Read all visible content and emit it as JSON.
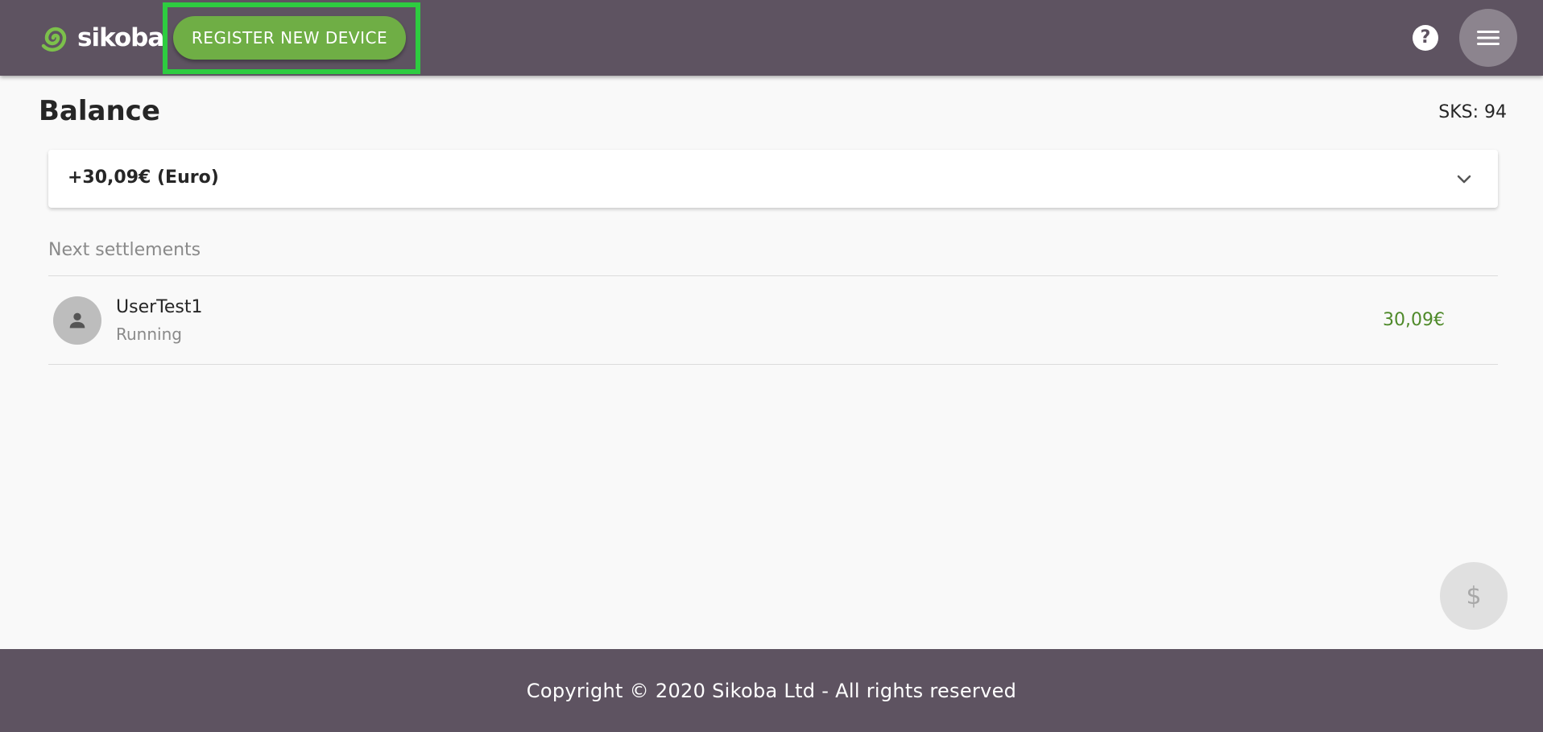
{
  "header": {
    "brand": "sikoba",
    "register_button_label": "REGISTER NEW DEVICE",
    "help_icon": "help-circle-icon",
    "menu_icon": "hamburger-menu-icon"
  },
  "main": {
    "title": "Balance",
    "sks_value": "SKS: 94",
    "balance_card": {
      "amount_label": "+30,09€ (Euro)",
      "expand_icon": "chevron-down-icon"
    },
    "settlements": {
      "section_title": "Next settlements",
      "items": [
        {
          "avatar_icon": "person-icon",
          "name": "UserTest1",
          "status": "Running",
          "amount": "30,09€"
        }
      ]
    },
    "fab": {
      "icon": "dollar-icon",
      "label": "$"
    }
  },
  "footer": {
    "copyright": "Copyright © 2020 Sikoba Ltd - All rights reserved"
  },
  "colors": {
    "header_bg": "#5e5361",
    "accent_green": "#6fae45",
    "highlight_green": "#2ecc40",
    "amount_green": "#4f8a2a"
  }
}
